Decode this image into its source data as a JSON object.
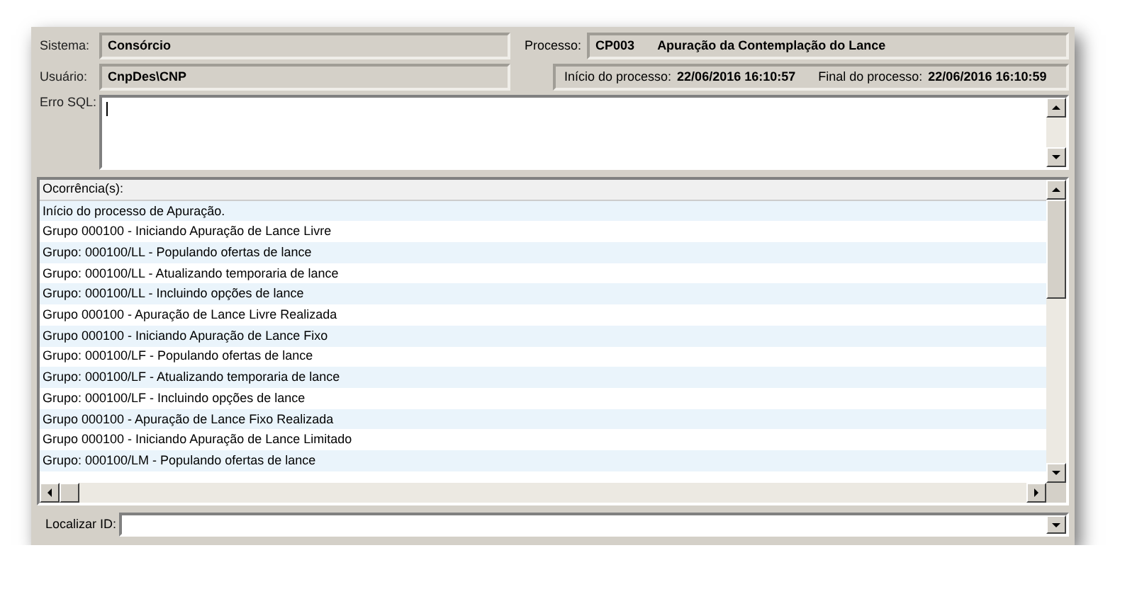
{
  "header": {
    "system_label": "Sistema:",
    "system": "Consórcio",
    "process_label": "Processo:",
    "process_code": "CP003",
    "process_name": "Apuração da Contemplação do Lance",
    "user_label": "Usuário:",
    "user": "CnpDes\\CNP",
    "start_label": "Início do processo:",
    "start": "22/06/2016 16:10:57",
    "end_label": "Final do processo:",
    "end": "22/06/2016 16:10:59"
  },
  "sql_error": {
    "label": "Erro SQL:"
  },
  "occurrences": {
    "header": "Ocorrência(s):",
    "rows": [
      "Início do processo de Apuração.",
      "Grupo 000100 - Iniciando Apuração de Lance Livre",
      "Grupo: 000100/LL - Populando ofertas de lance",
      "Grupo: 000100/LL - Atualizando temporaria de lance",
      "Grupo: 000100/LL - Incluindo opções de lance",
      "Grupo 000100 - Apuração de Lance Livre Realizada",
      "Grupo 000100 - Iniciando Apuração de Lance Fixo",
      "Grupo: 000100/LF - Populando ofertas de lance",
      "Grupo: 000100/LF - Atualizando temporaria de lance",
      "Grupo: 000100/LF - Incluindo opções de lance",
      "Grupo 000100 - Apuração de Lance Fixo Realizada",
      "Grupo 000100 - Iniciando Apuração de Lance Limitado",
      "Grupo: 000100/LM - Populando ofertas de lance"
    ]
  },
  "find": {
    "label": "Localizar ID:"
  }
}
